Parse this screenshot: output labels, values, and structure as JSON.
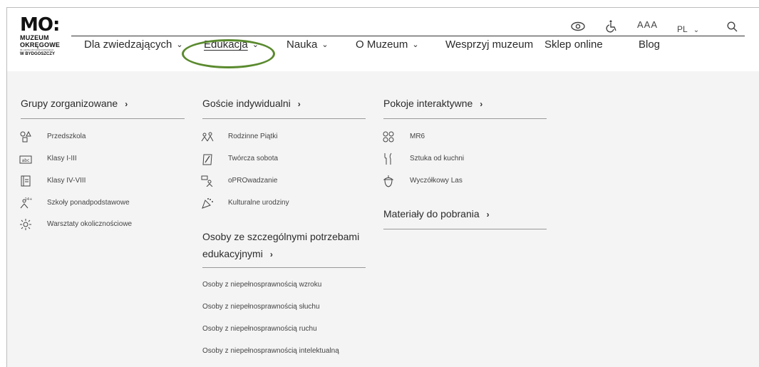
{
  "logo": {
    "mark": "MO:",
    "line1": "MUZEUM",
    "line2": "OKRĘGOWE",
    "small": "IM. LEONA WYCZÓŁKOWSKIEGO",
    "line3": "W BYDGOSZCZY"
  },
  "nav": [
    {
      "label": "Dla zwiedzających"
    },
    {
      "label": "Edukacja"
    },
    {
      "label": "Nauka"
    },
    {
      "label": "O Muzeum"
    },
    {
      "label": "Wesprzyj muzeum"
    },
    {
      "label": "Sklep online"
    },
    {
      "label": "Blog"
    }
  ],
  "utility": {
    "font_size": "AAA",
    "language": "PL"
  },
  "columns": {
    "col1": {
      "title": "Grupy zorganizowane",
      "items": [
        {
          "label": "Przedszkola",
          "icon": "shapes-icon"
        },
        {
          "label": "Klasy I-III",
          "icon": "abc-icon",
          "icon_text": "abc"
        },
        {
          "label": "Klasy IV-VIII",
          "icon": "notebook-icon"
        },
        {
          "label": "Szkoły ponadpodstawowe",
          "icon": "teen-icon",
          "icon_text": "14+"
        },
        {
          "label": "Warsztaty okolicznościowe",
          "icon": "sun-icon"
        }
      ]
    },
    "col2": {
      "title": "Goście indywidualni",
      "items": [
        {
          "label": "Rodzinne Piątki",
          "icon": "family-icon"
        },
        {
          "label": "Twórcza sobota",
          "icon": "brush-icon"
        },
        {
          "label": "oPROwadzanie",
          "icon": "guide-icon"
        },
        {
          "label": "Kulturalne urodziny",
          "icon": "party-icon"
        }
      ],
      "special_title_1": "Osoby ze szczególnymi potrzebami",
      "special_title_2": "edukacyjnymi",
      "special_items": [
        "Osoby z niepełnosprawnością wzroku",
        "Osoby z niepełnosprawnością słuchu",
        "Osoby z niepełnosprawnością ruchu",
        "Osoby z niepełnosprawnością intelektualną"
      ]
    },
    "col3": {
      "title": "Pokoje interaktywne",
      "items": [
        {
          "label": "MR6",
          "icon": "faces-icon"
        },
        {
          "label": "Sztuka od kuchni",
          "icon": "cutlery-icon"
        },
        {
          "label": "Wyczółkowy Las",
          "icon": "acorn-icon"
        }
      ],
      "downloads_title": "Materiały do pobrania"
    }
  },
  "colors": {
    "highlight": "#5a8a2e",
    "panel_bg": "#f4f4f4"
  }
}
